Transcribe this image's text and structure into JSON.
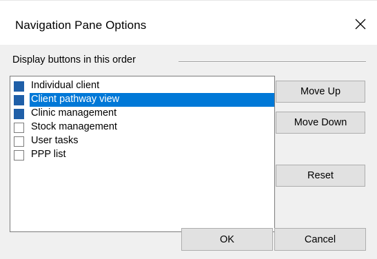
{
  "dialog": {
    "title": "Navigation Pane Options"
  },
  "group": {
    "label": "Display buttons in this order"
  },
  "list": {
    "items": [
      {
        "label": "Individual client",
        "checked": true,
        "selected": false
      },
      {
        "label": "Client pathway view",
        "checked": true,
        "selected": true
      },
      {
        "label": "Clinic management",
        "checked": true,
        "selected": false
      },
      {
        "label": "Stock management",
        "checked": false,
        "selected": false
      },
      {
        "label": "User tasks",
        "checked": false,
        "selected": false
      },
      {
        "label": "PPP list",
        "checked": false,
        "selected": false
      }
    ]
  },
  "buttons": {
    "move_up": "Move Up",
    "move_down": "Move Down",
    "reset": "Reset",
    "ok": "OK",
    "cancel": "Cancel"
  },
  "colors": {
    "selection": "#0078d7",
    "checkbox_fill": "#1f5fa8",
    "dialog_bg": "#f0f0f0"
  }
}
